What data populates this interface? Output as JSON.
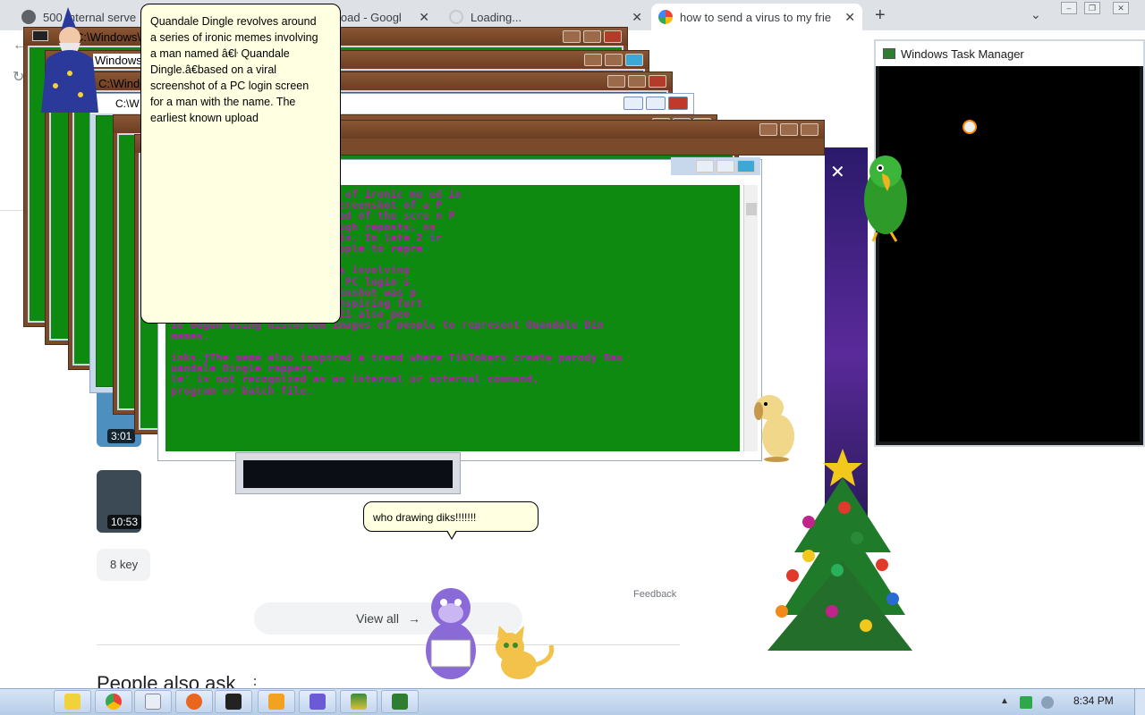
{
  "browser": {
    "tabs": [
      {
        "label": "500 Internal serve",
        "active": false
      },
      {
        "label": "load - Googl",
        "active": false
      },
      {
        "label": "Loading...",
        "active": false
      },
      {
        "label": "how to send a virus to my frie",
        "active": true
      }
    ],
    "new_tab": "+",
    "menu": "⌄",
    "close": "✕"
  },
  "page": {
    "video1_duration": "3:01",
    "video2_duration": "10:53",
    "key_moments": "8 key",
    "view_all": "View all",
    "feedback": "Feedback",
    "people_also_ask": "People also ask",
    "more_dots": "⋮"
  },
  "windows": {
    "cmd_title_1": "C:\\Windows\\syste",
    "cmd_title_2": "Windows\\",
    "cmd_title_3": "C:\\Windo",
    "cmd_title_4": "C:\\W",
    "front_title": "e",
    "task_manager_title": "Windows Task Manager"
  },
  "console_lines": [
    "e revolves around a series of ironic me ed in",
    "gle.ƒ€¥ based on a viral screenshot of a P",
    "e. The earliest known upload of the scre n P",
    "r 2021 and went viral through reposts, ns",
    "ame and how ridiculous it is. In late 2 ir",
    "ing distorted images of people to repre",
    "",
    "ad a series of ironic memes involving",
    " on a viral screenshot of a PC login s",
    "t known upload of the screenshot was p",
    "t viral through reposts, inspiring furt",
    "diculous it is. In late 2021 also peo",
    "ie began using distorted images of people to represent Quandale Din",
    " memes.",
    "",
    "inks.ƒThe meme also inspired a trend where TikTokers create parody Bas",
    "uandale Dingle rappers.",
    "le' is not recognized as an internal or external command,",
    "program or batch file."
  ],
  "balloons": {
    "main_lines": [
      "Quandale Dingle revolves around",
      "a series of ironic memes involving",
      "a man named â€ŀ Quandale",
      "Dingle.â€based on a viral",
      "screenshot of a PC login screen",
      "for a man with the name. The",
      "earliest known upload"
    ],
    "small": "who drawing diks!!!!!!!"
  },
  "taskbar": {
    "time": "8:34 PM"
  },
  "colors": {
    "console_green": "#0e8a10",
    "console_text": "#b21fae",
    "balloon_bg": "#ffffe1",
    "taskbar": "#c3d6ee"
  }
}
